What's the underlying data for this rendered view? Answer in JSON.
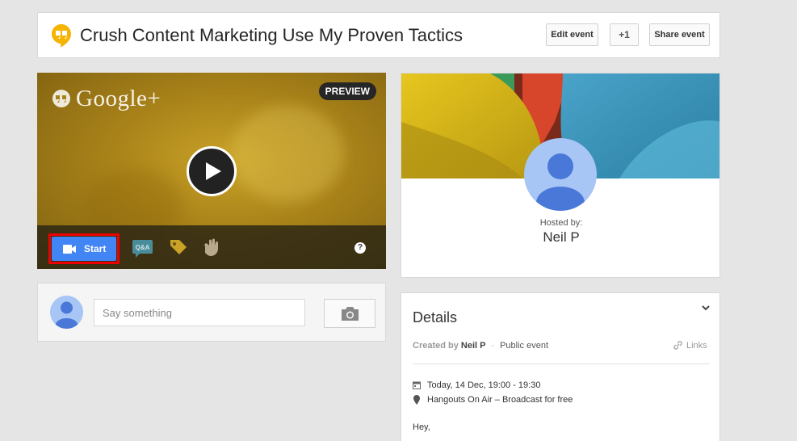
{
  "header": {
    "title": "Crush Content Marketing Use My Proven Tactics",
    "edit_label": "Edit event",
    "plus_label": "+1",
    "share_label": "Share event"
  },
  "video": {
    "brand": "Google+",
    "badge": "PREVIEW",
    "start_label": "Start",
    "help_label": "?"
  },
  "comment": {
    "placeholder": "Say something"
  },
  "host": {
    "hosted_by_label": "Hosted by:",
    "name": "Neil P"
  },
  "details": {
    "title": "Details",
    "created_by_label": "Created by",
    "creator": "Neil P",
    "separator": "·",
    "visibility": "Public event",
    "links_label": "Links",
    "date": "Today, 14 Dec, 19:00 - 19:30",
    "location": "Hangouts On Air – Broadcast for free",
    "body_start": "Hey,"
  },
  "colors": {
    "accent_blue": "#4285f4",
    "highlight_red": "#ee0000",
    "hangouts_yellow": "#f4b400"
  },
  "icons": [
    "hangouts-logo-icon",
    "play-icon",
    "video-camera-icon",
    "qa-icon",
    "tag-icon",
    "hand-icon",
    "help-icon",
    "camera-icon",
    "chevron-down-icon",
    "link-icon",
    "calendar-icon",
    "location-pin-icon"
  ]
}
